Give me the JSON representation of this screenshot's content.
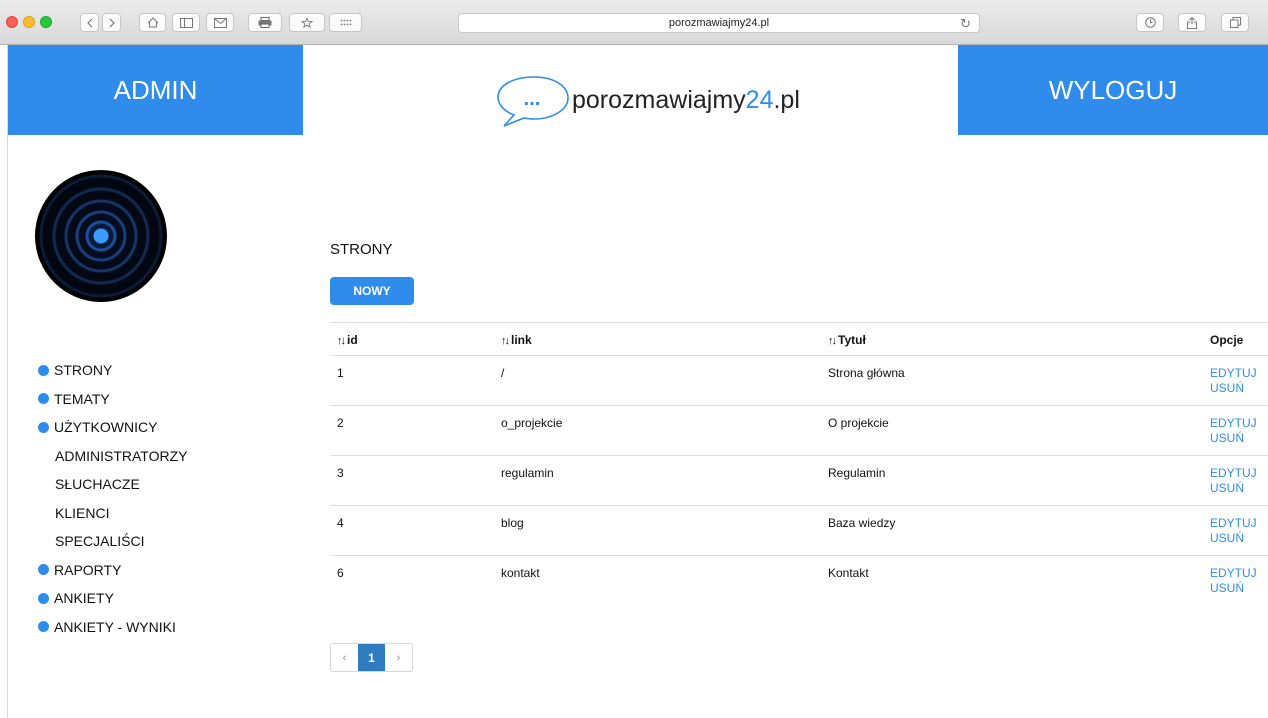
{
  "browser": {
    "url": "porozmawiajmy24.pl"
  },
  "header": {
    "left_label": "ADMIN",
    "right_label": "WYLOGUJ",
    "logo": {
      "prefix": "porozmawiajmy",
      "number": "24",
      "suffix": ".pl",
      "bubble": "..."
    }
  },
  "sidebar": {
    "items": [
      {
        "label": "STRONY",
        "bullet": true
      },
      {
        "label": "TEMATY",
        "bullet": true
      },
      {
        "label": "UŻYTKOWNICY",
        "bullet": true
      },
      {
        "label": "ADMINISTRATORZY",
        "bullet": false
      },
      {
        "label": "SŁUCHACZE",
        "bullet": false
      },
      {
        "label": "KLIENCI",
        "bullet": false
      },
      {
        "label": "SPECJALIŚCI",
        "bullet": false
      },
      {
        "label": "RAPORTY",
        "bullet": true
      },
      {
        "label": "ANKIETY",
        "bullet": true
      },
      {
        "label": "ANKIETY - WYNIKI",
        "bullet": true
      }
    ]
  },
  "main": {
    "title": "STRONY",
    "new_button": "NOWY",
    "columns": {
      "id": "id",
      "link": "link",
      "title": "Tytuł",
      "options": "Opcje"
    },
    "rows": [
      {
        "id": "1",
        "link": "/",
        "title": "Strona główna",
        "edit": "EDYTUJ",
        "delete": "USUŃ"
      },
      {
        "id": "2",
        "link": "o_projekcie",
        "title": "O projekcie",
        "edit": "EDYTUJ",
        "delete": "USUŃ"
      },
      {
        "id": "3",
        "link": "regulamin",
        "title": "Regulamin",
        "edit": "EDYTUJ",
        "delete": "USUŃ"
      },
      {
        "id": "4",
        "link": "blog",
        "title": "Baza wiedzy",
        "edit": "EDYTUJ",
        "delete": "USUŃ"
      },
      {
        "id": "6",
        "link": "kontakt",
        "title": "Kontakt",
        "edit": "EDYTUJ",
        "delete": "USUŃ"
      }
    ],
    "pagination": {
      "prev": "‹",
      "current": "1",
      "next": "›"
    }
  },
  "colors": {
    "accent": "#2f8ceb",
    "page_active": "#2f7dc0"
  }
}
